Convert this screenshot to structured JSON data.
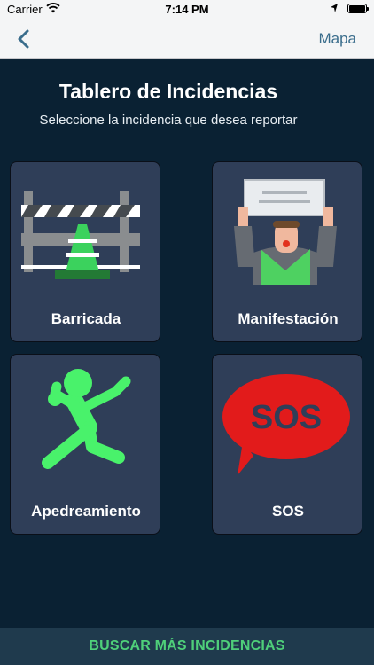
{
  "status_bar": {
    "carrier": "Carrier",
    "time": "7:14 PM"
  },
  "nav": {
    "right_label": "Mapa"
  },
  "header": {
    "title": "Tablero de Incidencias",
    "subtitle": "Seleccione la incidencia que desea reportar"
  },
  "cards": [
    {
      "label": "Barricada",
      "icon": "barricade-icon"
    },
    {
      "label": "Manifestación",
      "icon": "protester-icon"
    },
    {
      "label": "Apedreamiento",
      "icon": "stone-thrower-icon"
    },
    {
      "label": "SOS",
      "icon": "sos-bubble-icon",
      "sos_text": "SOS"
    }
  ],
  "bottom": {
    "button_label": "BUSCAR MÁS INCIDENCIAS"
  },
  "colors": {
    "background": "#0a2133",
    "card": "#2f3e58",
    "accent_green": "#4fd07a",
    "sos_red": "#e21b1b"
  }
}
